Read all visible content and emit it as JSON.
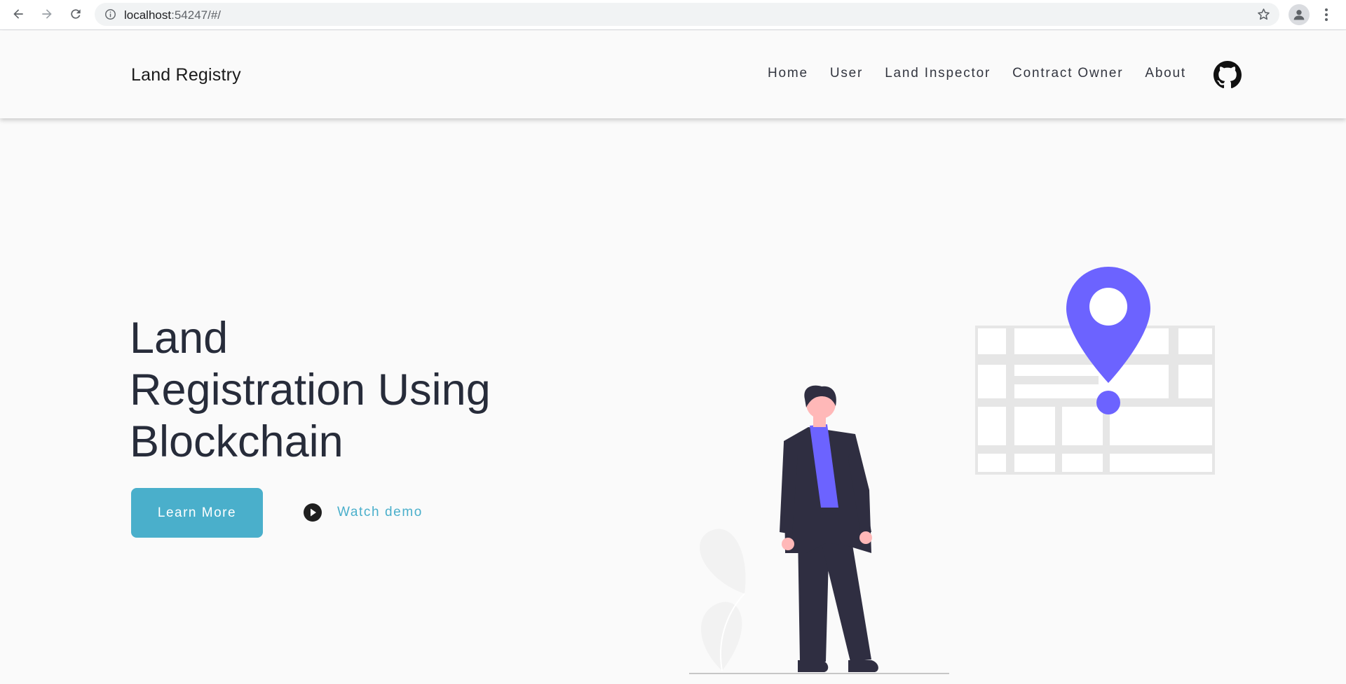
{
  "browser": {
    "url_host": "localhost",
    "url_rest": ":54247/#/"
  },
  "header": {
    "brand": "Land Registry",
    "nav": [
      "Home",
      "User",
      "Land Inspector",
      "Contract Owner",
      "About"
    ]
  },
  "hero": {
    "title_line1": "Land",
    "title_line2": "Registration Using",
    "title_line3": "Blockchain",
    "primary_button": "Learn More",
    "secondary_link": "Watch demo"
  },
  "colors": {
    "accent": "#4aafcb",
    "illustration_purple": "#6c63ff",
    "text_dark": "#272c3a"
  }
}
